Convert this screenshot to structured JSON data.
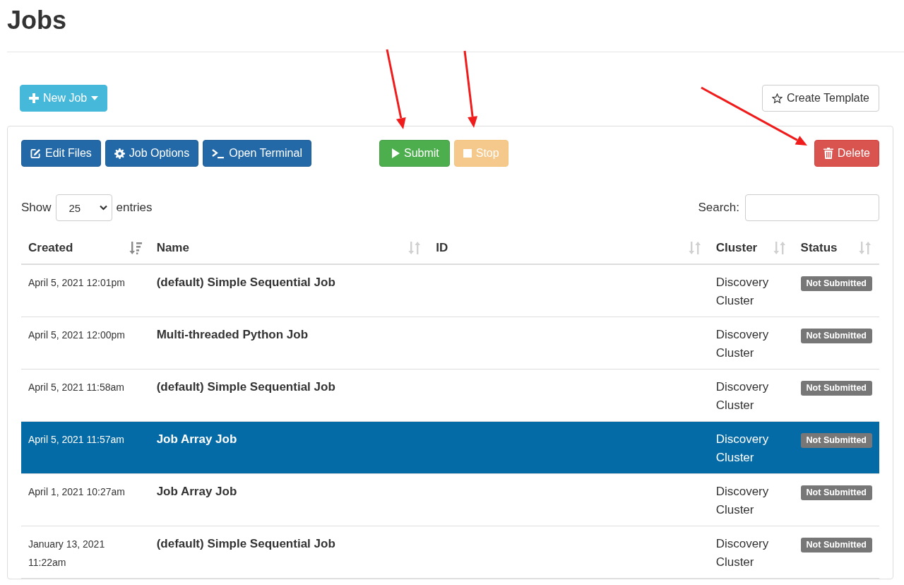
{
  "page": {
    "title": "Jobs"
  },
  "top_buttons": [
    {
      "label": "New Job",
      "kind": "info",
      "dropdown": true
    },
    {
      "label": "Create Template",
      "kind": "default",
      "dropdown": false
    }
  ],
  "toolbar": {
    "left": [
      {
        "label": "Edit Files",
        "kind": "primary",
        "disabled": false
      },
      {
        "label": "Job Options",
        "kind": "primary",
        "disabled": false
      },
      {
        "label": "Open Terminal",
        "kind": "primary",
        "disabled": false
      }
    ],
    "middle": [
      {
        "label": "Submit",
        "kind": "success",
        "disabled": false
      },
      {
        "label": "Stop",
        "kind": "warning",
        "disabled": true
      }
    ],
    "right": [
      {
        "label": "Delete",
        "kind": "danger",
        "disabled": false
      }
    ]
  },
  "length_menu": {
    "before": "Show",
    "value": "25",
    "after": "entries"
  },
  "search": {
    "label": "Search:"
  },
  "table": {
    "columns": [
      {
        "label": "Created",
        "sorted": true
      },
      {
        "label": "Name",
        "sorted": false
      },
      {
        "label": "ID",
        "sorted": false
      },
      {
        "label": "Cluster",
        "sorted": false
      },
      {
        "label": "Status",
        "sorted": false
      }
    ],
    "rows": [
      {
        "created": "April 5, 2021 12:01pm",
        "name": "(default) Simple Sequential Job",
        "cluster": "Discovery Cluster",
        "status": "Not Submitted",
        "selected": false
      },
      {
        "created": "April 5, 2021 12:00pm",
        "name": "Multi-threaded Python Job",
        "cluster": "Discovery Cluster",
        "status": "Not Submitted",
        "selected": false
      },
      {
        "created": "April 5, 2021 11:58am",
        "name": "(default) Simple Sequential Job",
        "cluster": "Discovery Cluster",
        "status": "Not Submitted",
        "selected": false
      },
      {
        "created": "April 5, 2021 11:57am",
        "name": "Job Array Job",
        "cluster": "Discovery Cluster",
        "status": "Not Submitted",
        "selected": true
      },
      {
        "created": "April 1, 2021 10:27am",
        "name": "Job Array Job",
        "cluster": "Discovery Cluster",
        "status": "Not Submitted",
        "selected": false
      },
      {
        "created": "January 13, 2021 11:22am",
        "name": "(default) Simple Sequential Job",
        "cluster": "Discovery Cluster",
        "status": "Not Submitted",
        "selected": false
      }
    ]
  }
}
